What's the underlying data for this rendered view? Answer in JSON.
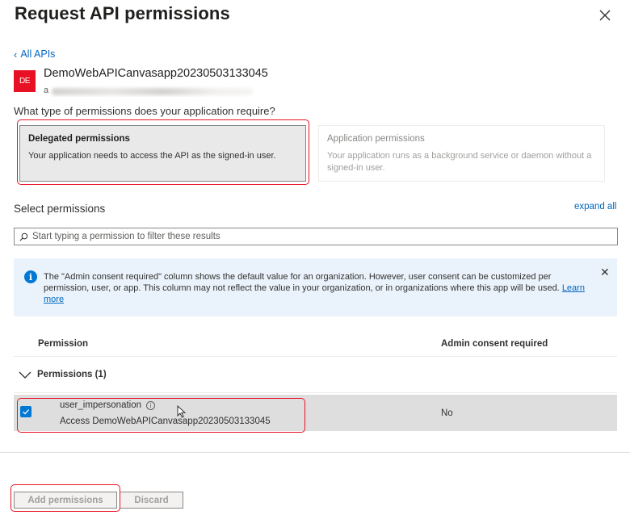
{
  "panel": {
    "title": "Request API permissions",
    "close_icon": "close-icon"
  },
  "nav": {
    "back_label": "All APIs"
  },
  "api": {
    "logo_text": "DE",
    "logo_color": "#e81123",
    "name": "DemoWebAPICanvasapp20230503133045",
    "subtitle_prefix": "a"
  },
  "question": "What type of permissions does your application require?",
  "permission_types": {
    "delegated": {
      "title": "Delegated permissions",
      "description": "Your application needs to access the API as the signed-in user."
    },
    "application": {
      "title": "Application permissions",
      "description": "Your application runs as a background service or daemon without a signed-in user."
    }
  },
  "select_section": {
    "title": "Select permissions",
    "expand_all": "expand all",
    "filter_placeholder": "Start typing a permission to filter these results"
  },
  "info_banner": {
    "text": "The \"Admin consent required\" column shows the default value for an organization. However, user consent can be customized per permission, user, or app. This column may not reflect the value in your organization, or in organizations where this app will be used.",
    "link_text": "Learn more"
  },
  "table": {
    "headers": [
      "Permission",
      "Admin consent required"
    ],
    "group_label": "Permissions (1)",
    "rows": [
      {
        "name": "user_impersonation",
        "description": "Access DemoWebAPICanvasapp20230503133045",
        "admin_consent": "No",
        "checked": true
      }
    ]
  },
  "footer": {
    "add_button": "Add permissions",
    "discard_button": "Discard"
  },
  "colors": {
    "accent": "#0078d4",
    "link": "#0066c0",
    "highlight": "#e81123"
  }
}
